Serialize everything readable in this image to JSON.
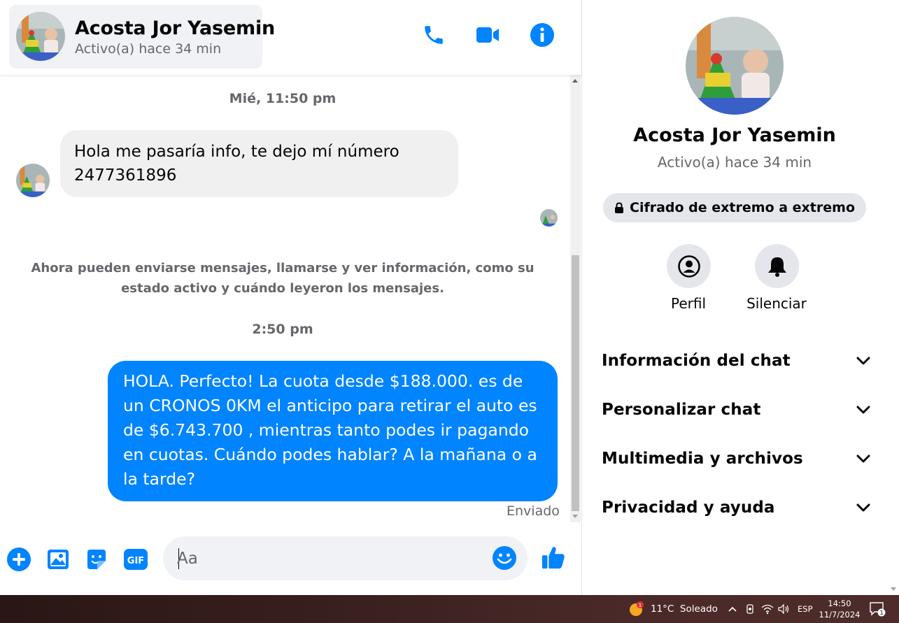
{
  "header": {
    "contact_name": "Acosta Jor Yasemin",
    "contact_status": "Activo(a) hace 34 min",
    "icons": [
      "phone-icon",
      "video-icon",
      "info-icon"
    ]
  },
  "messages": {
    "timestamp_1": "Mié, 11:50 pm",
    "incoming_text": "Hola me pasaría info, te dejo mí número 2477361896",
    "system_note": "Ahora pueden enviarse mensajes, llamarse y ver información, como su estado activo y cuándo leyeron los mensajes.",
    "timestamp_2": "2:50 pm",
    "outgoing_text": "HOLA. Perfecto! La cuota desde $188.000. es de un CRONOS 0KM el anticipo para retirar el auto es de $6.743.700 , mientras tanto podes ir pagando en cuotas. Cuándo podes hablar? A la mañana o a la tarde?",
    "sent_label": "Enviado"
  },
  "composer": {
    "placeholder": "Aa",
    "gif_label": "GIF",
    "icons": [
      "add-icon",
      "gallery-icon",
      "sticker-icon",
      "gif-icon",
      "emoji-icon",
      "thumbs-up-icon"
    ]
  },
  "info_panel": {
    "name": "Acosta Jor Yasemin",
    "status": "Activo(a) hace 34 min",
    "encryption_label": "Cifrado de extremo a extremo",
    "profile_label": "Perfil",
    "mute_label": "Silenciar",
    "sections": [
      {
        "label": "Información del chat"
      },
      {
        "label": "Personalizar chat"
      },
      {
        "label": "Multimedia y archivos"
      },
      {
        "label": "Privacidad y ayuda"
      }
    ]
  },
  "taskbar": {
    "weather_badge": "1",
    "weather": "11°C  Soleado",
    "language": "ESP",
    "time": "14:50",
    "date": "11/7/2024",
    "notification_count": "1"
  },
  "colors": {
    "accent": "#0084ff",
    "incoming_bubble": "#f0f0f0",
    "muted_text": "#65676b"
  }
}
